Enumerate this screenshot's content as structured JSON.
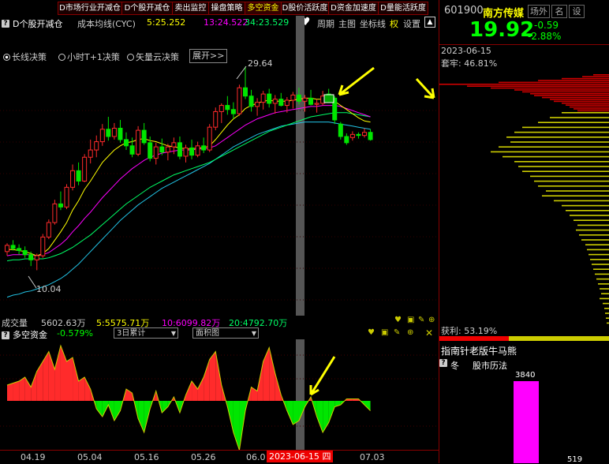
{
  "topbar": {
    "buttons": [
      "D市场行业开减仓",
      "D个股开减仓",
      "卖出监控",
      "操盘策略",
      "多空资金",
      "D股价活跃度",
      "D资金加速度",
      "D量能活跃度"
    ],
    "active_index": 4
  },
  "chart_header": {
    "indicator_name": "D个股开减仓",
    "ma_label": "成本均线(CYC)",
    "ma5": "5:25.252",
    "ma13": "13:24.522",
    "ma34": "34:23.529",
    "menu": [
      "周期",
      "主图",
      "坐标线",
      "权",
      "设置"
    ]
  },
  "strategy": {
    "options": [
      "长线决策",
      "小时T+1决策",
      "矢量云决策"
    ],
    "selected": 0,
    "expand_label": "展开>>"
  },
  "price_annotations": {
    "high": "29.64",
    "low": "10.04"
  },
  "volume": {
    "label": "成交量",
    "value": "5602.63万",
    "v5": "5:5575.71万",
    "v10": "10:6099.82万",
    "v20": "20:4792.70万"
  },
  "fund": {
    "label": "多空资金",
    "value": "-0.579%",
    "period_select": "3日累计",
    "type_select": "面积图"
  },
  "xaxis": {
    "ticks": [
      "04.19",
      "05.04",
      "05.16",
      "05.26",
      "06.0",
      "07.03"
    ],
    "highlight_date": "2023-06-15",
    "highlight_weekday": "四"
  },
  "quote": {
    "code": "601900",
    "name": "南方传媒",
    "btn_board": "场外",
    "btn_name": "名",
    "btn_edit": "设",
    "price": "19.92",
    "change": "-0.59",
    "change_pct": "-2.88%"
  },
  "chips": {
    "date": "2023-06-15",
    "trapped_label": "套牢: 46.81%",
    "profit_label": "获利: 53.19%"
  },
  "guide": {
    "title": "指南针老版牛马熊",
    "season": "冬",
    "history": "股市历法",
    "bar_value": "3840",
    "bar2_value": "519"
  },
  "colors": {
    "up": "#ff2b2b",
    "down": "#00e600",
    "ma5": "#ffff00",
    "ma13": "#ff00ff",
    "ma34": "#00ff66",
    "ma_long": "#22c4e6",
    "accent": "#ffff00"
  },
  "chart_data": {
    "type": "candlestick",
    "candles": [
      [
        11.8,
        12.6,
        11.4,
        12.4
      ],
      [
        12.4,
        12.9,
        11.9,
        12.1
      ],
      [
        12.1,
        12.5,
        11.5,
        11.9
      ],
      [
        11.9,
        12.3,
        11.2,
        11.5
      ],
      [
        11.5,
        11.8,
        10.4,
        11.0
      ],
      [
        11.0,
        11.6,
        10.0,
        11.4
      ],
      [
        11.4,
        13.5,
        11.2,
        13.2
      ],
      [
        13.2,
        14.9,
        13.0,
        14.6
      ],
      [
        14.6,
        16.8,
        14.4,
        16.4
      ],
      [
        16.4,
        17.6,
        15.8,
        16.1
      ],
      [
        16.1,
        18.3,
        15.9,
        18.0
      ],
      [
        18.0,
        20.2,
        17.7,
        19.6
      ],
      [
        19.6,
        20.4,
        18.2,
        18.6
      ],
      [
        18.6,
        21.2,
        18.5,
        20.9
      ],
      [
        20.9,
        22.6,
        20.3,
        21.6
      ],
      [
        21.6,
        23.0,
        20.9,
        22.4
      ],
      [
        22.4,
        24.1,
        22.0,
        23.6
      ],
      [
        23.6,
        24.8,
        22.5,
        22.9
      ],
      [
        22.9,
        24.2,
        22.6,
        23.7
      ],
      [
        23.7,
        24.5,
        22.3,
        22.6
      ],
      [
        22.6,
        23.3,
        21.6,
        22.0
      ],
      [
        22.0,
        22.8,
        20.9,
        21.2
      ],
      [
        21.2,
        23.9,
        21.0,
        23.5
      ],
      [
        23.5,
        24.2,
        22.1,
        22.3
      ],
      [
        22.3,
        22.9,
        20.5,
        20.8
      ],
      [
        20.8,
        22.3,
        20.2,
        21.9
      ],
      [
        21.9,
        22.7,
        21.1,
        21.4
      ],
      [
        21.4,
        22.2,
        20.6,
        21.9
      ],
      [
        21.9,
        22.8,
        21.2,
        22.3
      ],
      [
        22.3,
        22.9,
        20.7,
        21.0
      ],
      [
        21.0,
        22.1,
        20.4,
        21.8
      ],
      [
        21.8,
        22.6,
        20.7,
        21.1
      ],
      [
        21.1,
        22.4,
        20.9,
        22.0
      ],
      [
        22.0,
        22.8,
        21.3,
        21.6
      ],
      [
        21.6,
        24.1,
        21.4,
        23.8
      ],
      [
        23.8,
        25.7,
        23.5,
        25.3
      ],
      [
        25.3,
        26.1,
        24.2,
        25.9
      ],
      [
        25.9,
        26.8,
        25.0,
        25.5
      ],
      [
        25.5,
        26.2,
        24.6,
        25.1
      ],
      [
        25.1,
        27.9,
        24.9,
        27.6
      ],
      [
        27.6,
        29.64,
        26.5,
        26.8
      ],
      [
        26.8,
        27.4,
        25.3,
        25.8
      ],
      [
        25.8,
        26.6,
        24.9,
        26.2
      ],
      [
        26.2,
        27.3,
        25.5,
        27.0
      ],
      [
        27.0,
        27.5,
        25.7,
        26.1
      ],
      [
        26.1,
        26.9,
        25.1,
        26.5
      ],
      [
        26.5,
        27.1,
        25.8,
        25.9
      ],
      [
        25.9,
        26.7,
        25.2,
        26.4
      ],
      [
        26.4,
        27.2,
        25.6,
        26.9
      ],
      [
        26.9,
        27.6,
        26.0,
        26.3
      ],
      [
        26.3,
        26.9,
        25.3,
        26.6
      ],
      [
        26.6,
        27.4,
        25.9,
        26.0
      ],
      [
        26.0,
        26.5,
        25.2,
        26.1
      ],
      [
        26.1,
        27.3,
        25.9,
        26.8
      ],
      [
        27.0,
        27.5,
        26.2,
        26.6
      ],
      [
        26.6,
        26.8,
        24.1,
        24.5
      ],
      [
        24.1,
        24.3,
        22.6,
        22.9
      ],
      [
        22.9,
        23.2,
        22.1,
        22.3
      ],
      [
        22.8,
        23.4,
        22.5,
        23.1
      ],
      [
        23.1,
        23.3,
        22.7,
        23.0
      ],
      [
        23.0,
        23.7,
        22.8,
        23.3
      ],
      [
        23.3,
        23.6,
        22.5,
        22.6
      ]
    ],
    "ma_short": [
      12.0,
      12.0,
      11.9,
      11.8,
      11.6,
      11.4,
      11.6,
      12.1,
      12.9,
      13.7,
      14.6,
      15.8,
      16.7,
      17.8,
      18.6,
      19.5,
      20.4,
      21.0,
      21.6,
      22.0,
      22.3,
      22.4,
      22.6,
      22.7,
      22.5,
      22.4,
      22.2,
      22.0,
      21.9,
      21.8,
      21.7,
      21.7,
      21.8,
      21.8,
      22.0,
      22.6,
      23.3,
      24.0,
      24.6,
      25.0,
      25.6,
      25.9,
      26.1,
      26.3,
      26.4,
      26.3,
      26.3,
      26.3,
      26.4,
      26.5,
      26.6,
      26.6,
      26.5,
      26.5,
      26.5,
      26.3,
      25.9,
      25.5,
      25.1,
      24.7,
      24.4,
      24.3
    ],
    "ma_mid": [
      11.4,
      11.5,
      11.5,
      11.5,
      11.5,
      11.4,
      11.5,
      11.7,
      12.1,
      12.5,
      13.0,
      13.7,
      14.3,
      15.0,
      15.6,
      16.3,
      17.0,
      17.6,
      18.2,
      18.8,
      19.3,
      19.8,
      20.2,
      20.6,
      20.9,
      21.1,
      21.3,
      21.4,
      21.5,
      21.6,
      21.6,
      21.6,
      21.7,
      21.7,
      21.8,
      22.0,
      22.4,
      22.8,
      23.2,
      23.6,
      24.0,
      24.3,
      24.6,
      24.8,
      25.0,
      25.2,
      25.3,
      25.4,
      25.5,
      25.6,
      25.7,
      25.8,
      25.8,
      25.9,
      25.9,
      25.9,
      25.8,
      25.6,
      25.4,
      25.2,
      25.0,
      24.8
    ],
    "ma_slow": [
      10.9,
      11.0,
      11.0,
      11.1,
      11.1,
      11.1,
      11.1,
      11.2,
      11.4,
      11.6,
      11.9,
      12.2,
      12.6,
      13.0,
      13.4,
      13.9,
      14.4,
      14.9,
      15.4,
      15.9,
      16.4,
      16.8,
      17.2,
      17.6,
      18.0,
      18.3,
      18.6,
      18.9,
      19.2,
      19.4,
      19.6,
      19.8,
      20.0,
      20.2,
      20.4,
      20.7,
      21.0,
      21.3,
      21.6,
      21.9,
      22.2,
      22.5,
      22.8,
      23.1,
      23.4,
      23.6,
      23.8,
      24.0,
      24.2,
      24.4,
      24.6,
      24.8,
      24.9,
      25.0,
      25.1,
      25.2,
      25.2,
      25.2,
      25.1,
      25.0,
      24.9,
      24.8
    ],
    "ma_long": [
      7.4,
      7.6,
      7.7,
      7.9,
      8.0,
      8.2,
      8.4,
      8.6,
      8.9,
      9.2,
      9.6,
      10.1,
      10.6,
      11.2,
      11.8,
      12.4,
      13.0,
      13.6,
      14.2,
      14.8,
      15.3,
      15.8,
      16.3,
      16.7,
      17.1,
      17.5,
      17.9,
      18.2,
      18.5,
      18.8,
      19.1,
      19.4,
      19.7,
      20.0,
      20.3,
      20.7,
      21.1,
      21.5,
      21.9,
      22.2,
      22.5,
      22.8,
      23.1,
      23.3,
      23.5,
      23.7,
      23.9,
      24.0,
      24.1,
      24.2,
      24.3,
      24.3,
      24.3,
      24.3,
      24.3,
      24.2,
      24.1,
      24.0,
      23.9,
      23.8,
      23.7,
      23.6
    ],
    "fund_flow": [
      0.8,
      0.9,
      1.0,
      1.2,
      0.7,
      1.5,
      2.0,
      2.5,
      1.6,
      2.8,
      2.0,
      2.2,
      1.0,
      1.2,
      0.6,
      -0.4,
      -0.8,
      -0.2,
      -1.0,
      -0.5,
      0.6,
      0.4,
      -0.9,
      -1.6,
      -0.4,
      0.5,
      -0.6,
      -0.3,
      0.2,
      -0.6,
      0.3,
      1.0,
      0.6,
      1.2,
      2.1,
      2.5,
      0.8,
      -0.3,
      -1.6,
      -2.5,
      -0.5,
      0.7,
      0.5,
      2.0,
      2.7,
      1.4,
      0.3,
      -0.5,
      -1.2,
      -1.0,
      -0.3,
      0.2,
      -0.8,
      -1.6,
      -1.1,
      -0.3,
      -0.2,
      0.1,
      0.1,
      0.1,
      -0.2,
      -0.5
    ]
  }
}
